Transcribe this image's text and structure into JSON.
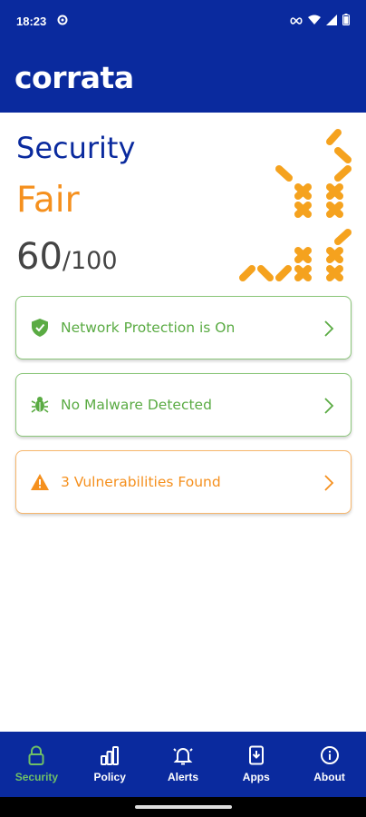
{
  "status_bar": {
    "time": "18:23",
    "icons": [
      "settings-dot-icon",
      "infinity-icon",
      "wifi-icon",
      "signal-icon",
      "battery-icon"
    ]
  },
  "app": {
    "logo_text": "corrata",
    "brand_color": "#0a2a9e"
  },
  "security": {
    "title": "Security",
    "status": "Fair",
    "score": "60",
    "score_max": "/100",
    "status_color": "#f5901e"
  },
  "cards": [
    {
      "label": "Network Protection is On",
      "icon": "shield-check-icon",
      "state": "ok"
    },
    {
      "label": "No Malware Detected",
      "icon": "bug-icon",
      "state": "ok"
    },
    {
      "label": "3 Vulnerabilities Found",
      "icon": "warning-icon",
      "state": "warn"
    }
  ],
  "bottom_nav": {
    "active": "Security",
    "items": [
      {
        "label": "Security",
        "icon": "lock-icon"
      },
      {
        "label": "Policy",
        "icon": "bar-chart-icon"
      },
      {
        "label": "Alerts",
        "icon": "bell-icon"
      },
      {
        "label": "Apps",
        "icon": "app-download-icon"
      },
      {
        "label": "About",
        "icon": "info-icon"
      }
    ]
  },
  "colors": {
    "ok": "#5aab43",
    "warn": "#f5901e",
    "nav_active": "#6fbf66"
  }
}
